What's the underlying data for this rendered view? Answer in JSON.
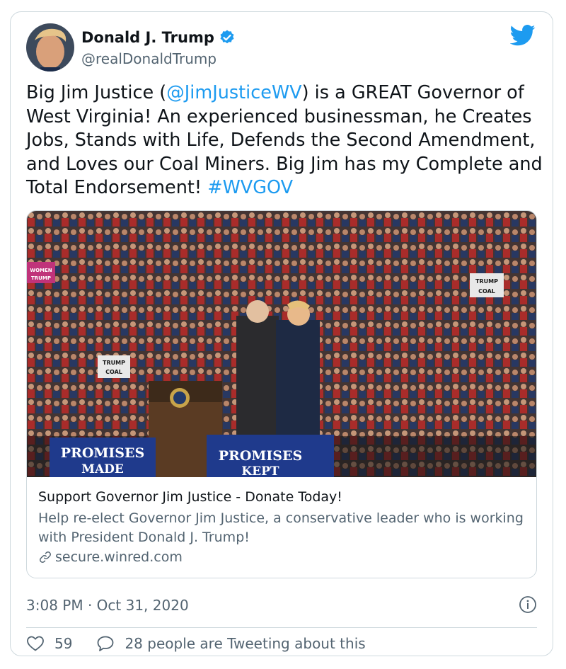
{
  "author": {
    "name": "Donald J. Trump",
    "handle": "@realDonaldTrump"
  },
  "tweet": {
    "text_part1": "Big Jim Justice (",
    "mention": "@JimJusticeWV",
    "text_part2": ") is a GREAT Governor of West Virginia! An experienced businessman, he Creates Jobs, Stands with Life, Defends the Second Amendment, and Loves our Coal Miners. Big Jim has my Complete and Total Endorsement! ",
    "hashtag": "#WVGOV"
  },
  "link_card": {
    "title": "Support Governor Jim Justice - Donate Today!",
    "description": "Help re-elect Governor Jim Justice, a conservative leader who is working with President Donald J. Trump!",
    "domain": "secure.winred.com",
    "image_sign_left": "PROMISES MADE",
    "image_sign_right": "PROMISES KEPT"
  },
  "meta": {
    "time": "3:08 PM",
    "separator": "·",
    "date": "Oct 31, 2020"
  },
  "engagement": {
    "likes": "59",
    "conversation": "28 people are Tweeting about this"
  },
  "colors": {
    "link": "#1d9bf0",
    "text": "#0f1419",
    "secondary": "#536471",
    "border": "#cfd9de"
  },
  "icons": [
    "verified-badge-icon",
    "twitter-bird-icon",
    "link-icon",
    "info-icon",
    "heart-icon",
    "speech-bubble-icon"
  ]
}
